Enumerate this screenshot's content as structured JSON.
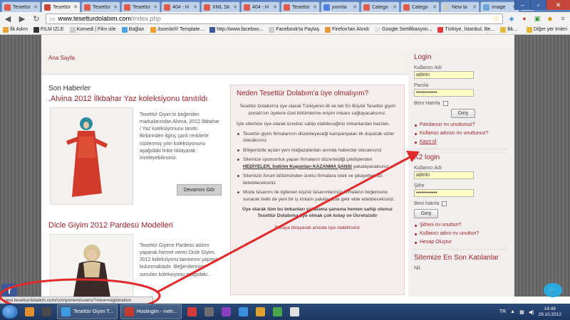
{
  "browser": {
    "tabs": [
      {
        "label": "Tesettür",
        "color": "#e25b4a",
        "active": false
      },
      {
        "label": "Tesettür",
        "color": "#c9443b",
        "active": true
      },
      {
        "label": "Tesettür",
        "color": "#e25b4a",
        "active": false
      },
      {
        "label": "Tesettür",
        "color": "#e25b4a",
        "active": false
      },
      {
        "label": "404 - H",
        "color": "#e25b4a",
        "active": false
      },
      {
        "label": "XML Sit",
        "color": "#e25b4a",
        "active": false
      },
      {
        "label": "404 - H",
        "color": "#e25b4a",
        "active": false
      },
      {
        "label": "Tesettür",
        "color": "#e25b4a",
        "active": false
      },
      {
        "label": "joomla",
        "color": "#4d7fe0",
        "active": false
      },
      {
        "label": "Catego",
        "color": "#e25b4a",
        "active": false
      },
      {
        "label": "Catego",
        "color": "#e25b4a",
        "active": false
      },
      {
        "label": "New ta",
        "color": "#cccccc",
        "active": false
      },
      {
        "label": "Image",
        "color": "#6aa5d8",
        "active": false
      }
    ],
    "url_host": "www.tesetturdolabim.com",
    "url_path": "/index.php",
    "bookmarks": [
      {
        "label": "İlk Adım",
        "color": "#e7a23a"
      },
      {
        "label": "FILM IZLE",
        "color": "#333333"
      },
      {
        "label": "Komedi | Film izle",
        "color": "#cccccc"
      },
      {
        "label": "Bağlan",
        "color": "#4ea4e0"
      },
      {
        "label": "Joomla!® Template...",
        "color": "#f1a02b"
      },
      {
        "label": "http://www.faceboo...",
        "color": "#3b5998"
      },
      {
        "label": "Facebook'ta Paylaş",
        "color": "#cccccc"
      },
      {
        "label": "Firefox'tan Alındı",
        "color": "#e79a3a"
      },
      {
        "label": "Google Sertifikasyon...",
        "color": "#e5e5e5"
      },
      {
        "label": "Türkiye, İstanbul, Be...",
        "color": "#e23b3b"
      },
      {
        "label": "Bk...",
        "color": "#e3b93a"
      }
    ],
    "bookmarks_other": "Diğer yer imleri",
    "status_url": "www.tesetturdolabim.com/component/users/?view=registration"
  },
  "site": {
    "breadcrumb": "Ana Sayfa",
    "news_heading": "Son Haberler",
    "article1": {
      "title": ".Alvina 2012 İlkbahar Yaz koleksiyonu tanıtıldı",
      "excerpt": "Tesettür Giyim'in beğenilen markalarından Alvina, 2012 İlkbahar / Yaz koleksiyonunu tanıttı. Birbirinden ilginç çanlı renklerle süslenmiş yılın koleksiyonunu aşağıdaki linke tıklayarak inceleyebilirsiniz.",
      "readmore": "Devamını Gör"
    },
    "article2": {
      "title": "Dicle Giyim 2012 Pardesü Modelleri",
      "excerpt": "Tesettür Giyime Pardesü atılımı yaparak hizmet veren Dicle Giyim, 2012 koleksiyonu tanıtımını yapmış bulunmaktadır. Beğenilerinize sunulan koleksiyonu aşağıdaki..."
    },
    "why": {
      "title": "Neden Tesettür Dolabım'a üye olmalıyım?",
      "intro": "Tesettür Dolabım'a üye olarak Türkiyenin ilk ve tek En Büyük Tesettür giyim portalı'nın üyelere özel bölümlerine erişim imkanı sağlayacaksınız.",
      "sub": "İşte sitemize üye olarak ücretsiz sahip olabileceğiniz imkanlardan bazıları.",
      "list": [
        "Tesettür giyim firmalarının düzenleyeceği kampanyaları ilk duyacak sizler olacaksınız",
        "Bölgenizde açılan yeni mağazalardan anında haberdar olacaksınız",
        "Moda tasarımı ile ilgilenen kişiniz tasarımlarınızı firmaların beğenisine sunarak belki de yeni bir iş imkanı yakalayarak gelir elde edebileceksiniz.",
        "Sitemizin forum bölümünden üretici firmalara istek ve şikayetlerinizi iletebileceksiniz"
      ],
      "sponsor_pre": "Sitemize sponsorluk yapan firmaların düzenlediği çekilişlerden",
      "sponsor_bold": "HEDİYELER, İndirim Kuponları KAZANMA ŞANSI",
      "sponsor_post": "yakalayacaksınız",
      "bold": "Üye olarak tüm bu imkanları yakalama şansına hemen sahip olunuz Tesettür Dolabıma üye olmak çok kolay ve Ücretsizdir",
      "link": "Buraya tıklayarak anında üye olabilirsiniz"
    },
    "login": {
      "title": "Login",
      "user_label": "Kullanıcı Adı",
      "user_value": "admin",
      "pass_label": "Parola",
      "pass_value": "••••••••••••",
      "remember": "Beni Hatırla",
      "button": "Giriş",
      "links": [
        "Parolanızı mı unuttunuz?",
        "Kullanıcı adınızı mı unuttunuz?",
        "Kayıt ol"
      ]
    },
    "k2login": {
      "title": "K2 login",
      "user_label": "Kullanıcı Adı",
      "user_value": "admin",
      "pass_label": "Şifre",
      "pass_value": "••••••••••••",
      "remember": "Beni hatırla",
      "button": "Giriş",
      "links": [
        "Şifreni mi unuttun?",
        "Kullanıcı adını mı unuttun?",
        "Hesap Oluştur"
      ]
    },
    "latest_title": "Sitemize En Son Katılanlar",
    "latest_first": "Nil."
  },
  "taskbar": {
    "items": [
      {
        "label": "Tesettür Giyim T...",
        "color": "#3f9be0"
      },
      {
        "label": "Hostingim - meh...",
        "color": "#c43a2f"
      }
    ],
    "icons": [
      "#e08f2f",
      "#4a4a4a",
      "#d43b3b",
      "#6d6d6d",
      "#8b3fc0",
      "#3b8ee0",
      "#e0a02f",
      "#4aa64a",
      "#e0e0e0"
    ],
    "lang": "TR",
    "time": "14:48",
    "date": "29.10.2012"
  },
  "annotation": {
    "color": "#e32a2a"
  }
}
